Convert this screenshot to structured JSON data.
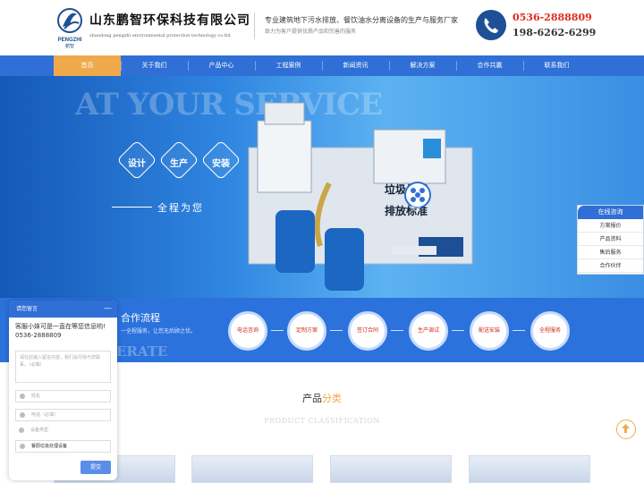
{
  "header": {
    "company_name": "山东鹏智环保科技有限公司",
    "company_en": "shandong pengzhi environmental protection technology co.ltd",
    "logo_text": "PENGZHI",
    "logo_cn": "鹏智",
    "tagline_1": "专业建筑地下污水排放、餐饮油水分离设备的生产与服务厂家",
    "tagline_2": "致力为客户提供优质产品和完善的服务",
    "phone_1": "0536-2888809",
    "phone_2": "198-6262-6299"
  },
  "nav": {
    "items": [
      {
        "label": "首页",
        "active": true
      },
      {
        "label": "关于我们"
      },
      {
        "label": "产品中心"
      },
      {
        "label": "工程案例"
      },
      {
        "label": "新闻资讯"
      },
      {
        "label": "解决方案"
      },
      {
        "label": "合作共赢"
      },
      {
        "label": "联系我们"
      }
    ]
  },
  "banner": {
    "en_text": "AT YOUR SERVICE",
    "hex_labels": [
      "设计",
      "生产",
      "安装"
    ],
    "service_text": "全程为您",
    "badge_label": "专业",
    "title_1": "垃圾处理",
    "title_2": "排放标准"
  },
  "process": {
    "title": "合作流程",
    "subtitle": "一全程服务，让您无后顾之忧。",
    "en": "ERATE",
    "steps": [
      "电话咨询",
      "定制方案",
      "签订合同",
      "生产调试",
      "配送安装",
      "全程服务"
    ]
  },
  "products": {
    "title_a": "产品",
    "title_b": "分类",
    "en": "PRODUCT CLASSIFICATION"
  },
  "consult": {
    "title": "在线咨询",
    "items": [
      "方案报价",
      "产品资料",
      "售后服务",
      "合作伙伴"
    ]
  },
  "chat": {
    "title": "请您留言",
    "minimize": "—",
    "greeting": "客服小妹可是一直在等您信息哟!",
    "phone": "0536-2888809",
    "message_placeholder": "请在此输入留言内容，我们会尽快与您联系。（必填）",
    "name_placeholder": "姓名",
    "tel_placeholder": "电话（必填）",
    "type_label": "设备类型",
    "type_value": "餐厨垃圾处理设备",
    "submit": "提交"
  },
  "colors": {
    "brand_blue": "#2f6fd6",
    "accent_orange": "#f0a94a",
    "phone_red": "#e02a1d"
  }
}
